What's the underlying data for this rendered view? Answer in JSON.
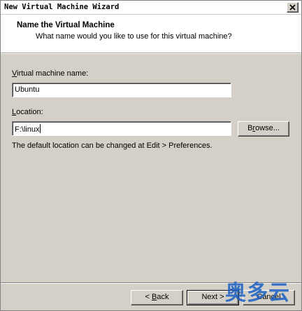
{
  "window": {
    "title": "New Virtual Machine Wizard",
    "close_icon": "close-icon"
  },
  "header": {
    "title": "Name the Virtual Machine",
    "subtitle": "What name would you like to use for this virtual machine?"
  },
  "form": {
    "name_label_mnemonic": "V",
    "name_label_rest": "irtual machine name:",
    "name_value": "Ubuntu",
    "location_label_mnemonic": "L",
    "location_label_rest": "ocation:",
    "location_value": "F:\\linux",
    "browse_mnemonic": "r",
    "browse_pre": "B",
    "browse_post": "owse...",
    "info": "The default location can be changed at Edit > Preferences."
  },
  "footer": {
    "back_pre": "< ",
    "back_mnemonic": "B",
    "back_post": "ack",
    "next_label": "Next >",
    "cancel_label": "Cancel"
  },
  "watermark": "奥多云"
}
